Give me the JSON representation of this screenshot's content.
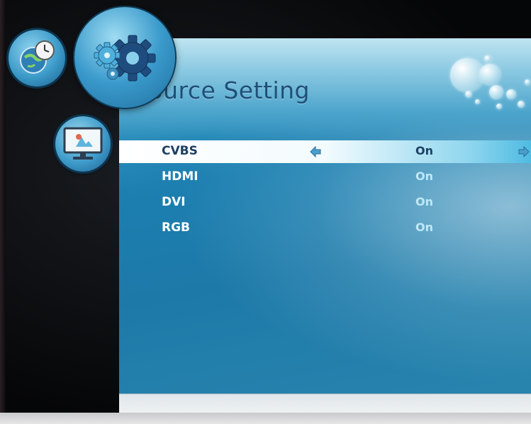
{
  "menu": {
    "title": "Source Setting",
    "categories": [
      {
        "name": "time",
        "icon": "globe-clock-icon"
      },
      {
        "name": "setup",
        "icon": "gears-icon",
        "active": true
      },
      {
        "name": "screen",
        "icon": "monitor-icon"
      }
    ],
    "items": [
      {
        "label": "CVBS",
        "value": "On",
        "selected": true
      },
      {
        "label": "HDMI",
        "value": "On",
        "selected": false
      },
      {
        "label": "DVI",
        "value": "On",
        "selected": false
      },
      {
        "label": "RGB",
        "value": "On",
        "selected": false
      }
    ]
  },
  "colors": {
    "panel": "#1d79a8",
    "title": "#1e4f78",
    "highlight": "#ffffff",
    "value_text": "#bfe8f6"
  }
}
